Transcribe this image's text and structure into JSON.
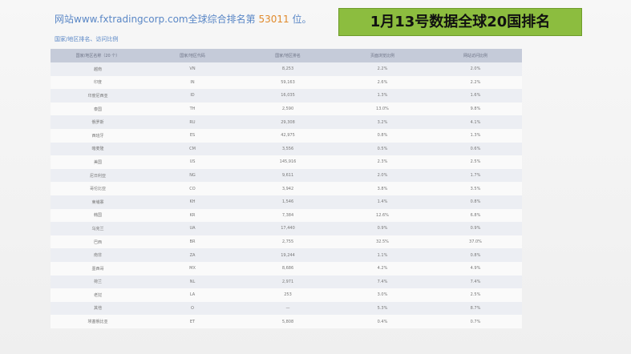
{
  "header": {
    "prefix": "网站",
    "url": "www.fxtradingcorp.com",
    "middle": "全球综合排名第",
    "rank": "53011",
    "suffix": "位。",
    "subtitle": "国家/地区排名、访问比例"
  },
  "banner": {
    "text": "1月13号数据全球20国排名"
  },
  "table": {
    "columns": [
      "国家/地区名称（20 个）",
      "国家/地区代码",
      "国家/地区排名",
      "页面浏览比例",
      "网站访问比例"
    ],
    "rows": [
      [
        "越南",
        "VN",
        "8,253",
        "2.2%",
        "2.0%"
      ],
      [
        "印度",
        "IN",
        "59,163",
        "2.6%",
        "2.2%"
      ],
      [
        "印度尼西亚",
        "ID",
        "16,035",
        "1.3%",
        "1.6%"
      ],
      [
        "泰国",
        "TH",
        "2,590",
        "13.0%",
        "9.8%"
      ],
      [
        "俄罗斯",
        "RU",
        "29,308",
        "3.2%",
        "4.1%"
      ],
      [
        "西班牙",
        "ES",
        "42,975",
        "0.8%",
        "1.3%"
      ],
      [
        "喀麦隆",
        "CM",
        "3,556",
        "0.5%",
        "0.6%"
      ],
      [
        "美国",
        "US",
        "145,916",
        "2.3%",
        "2.5%"
      ],
      [
        "尼日利亚",
        "NG",
        "9,611",
        "2.0%",
        "1.7%"
      ],
      [
        "哥伦比亚",
        "CO",
        "3,942",
        "3.8%",
        "3.5%"
      ],
      [
        "柬埔寨",
        "KH",
        "1,546",
        "1.4%",
        "0.8%"
      ],
      [
        "韩国",
        "KR",
        "7,384",
        "12.6%",
        "6.8%"
      ],
      [
        "乌克兰",
        "UA",
        "17,440",
        "0.9%",
        "0.9%"
      ],
      [
        "巴西",
        "BR",
        "2,755",
        "32.5%",
        "37.0%"
      ],
      [
        "南非",
        "ZA",
        "19,244",
        "1.1%",
        "0.8%"
      ],
      [
        "墨西哥",
        "MX",
        "8,686",
        "4.2%",
        "4.9%"
      ],
      [
        "荷兰",
        "NL",
        "2,971",
        "7.4%",
        "7.4%"
      ],
      [
        "老挝",
        "LA",
        "253",
        "3.0%",
        "2.5%"
      ],
      [
        "其他",
        "O",
        "—",
        "5.3%",
        "8.7%"
      ],
      [
        "埃塞俄比亚",
        "ET",
        "5,808",
        "0.4%",
        "0.7%"
      ]
    ]
  }
}
